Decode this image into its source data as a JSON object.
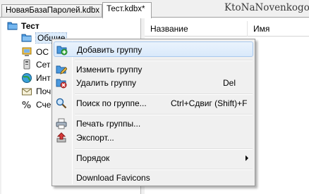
{
  "tabs": [
    {
      "label": "НоваяБазаПаролей.kdbx"
    },
    {
      "label": "Тест.kdbx*"
    }
  ],
  "watermark": "KtoNaNovenkogo.ru",
  "tree": {
    "root": "Тест",
    "items": [
      {
        "label": "Общие",
        "icon": "folder-icon"
      },
      {
        "label": "ОС",
        "icon": "os-icon"
      },
      {
        "label": "Сет",
        "icon": "network-icon"
      },
      {
        "label": "Инт",
        "icon": "internet-icon"
      },
      {
        "label": "Поч",
        "icon": "mail-icon"
      },
      {
        "label": "Сче",
        "icon": "percent-icon"
      }
    ]
  },
  "list": {
    "columns": [
      "Название",
      "Имя"
    ]
  },
  "context_menu": {
    "items": [
      {
        "label": "Добавить группу",
        "shortcut": "",
        "icon": "add-group-icon"
      },
      {
        "label": "Изменить группу",
        "shortcut": "",
        "icon": "edit-group-icon"
      },
      {
        "label": "Удалить группу",
        "shortcut": "Del",
        "icon": "delete-group-icon"
      },
      {
        "label": "Поиск по группе...",
        "shortcut": "Ctrl+Сдвиг (Shift)+F",
        "icon": "search-icon"
      },
      {
        "label": "Печать группы...",
        "shortcut": "",
        "icon": "printer-icon"
      },
      {
        "label": "Экспорт...",
        "shortcut": "",
        "icon": "export-icon"
      },
      {
        "label": "Порядок",
        "shortcut": "",
        "icon": ""
      },
      {
        "label": "Download Favicons",
        "shortcut": "",
        "icon": ""
      }
    ]
  }
}
